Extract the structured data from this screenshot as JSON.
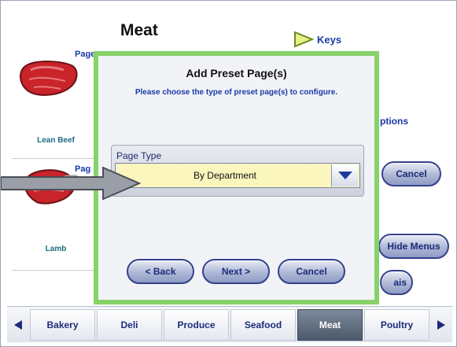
{
  "page": {
    "title": "Meat"
  },
  "header": {
    "keys_label": "Keys"
  },
  "items": [
    {
      "page_tag": "Page",
      "label": "Lean Beef"
    },
    {
      "page_tag": "Pag",
      "label": "Lamb"
    }
  ],
  "background_controls": {
    "options_label": "ptions",
    "cancel_label": "Cancel",
    "hide_menus_label": "Hide Menus",
    "ais_label": "ais"
  },
  "dialog": {
    "title": "Add Preset Page(s)",
    "instruction": "Please choose the type of preset page(s) to configure.",
    "page_type": {
      "label": "Page Type",
      "selected": "By Department"
    },
    "buttons": {
      "back": "< Back",
      "next": "Next >",
      "cancel": "Cancel"
    }
  },
  "tabs": [
    "Bakery",
    "Deli",
    "Produce",
    "Seafood",
    "Meat",
    "Poultry"
  ],
  "active_tab": "Meat",
  "colors": {
    "dialog_border": "#88d26a",
    "select_bg": "#fbf6bd",
    "link": "#1a3aa6",
    "button_border": "#33418a"
  }
}
